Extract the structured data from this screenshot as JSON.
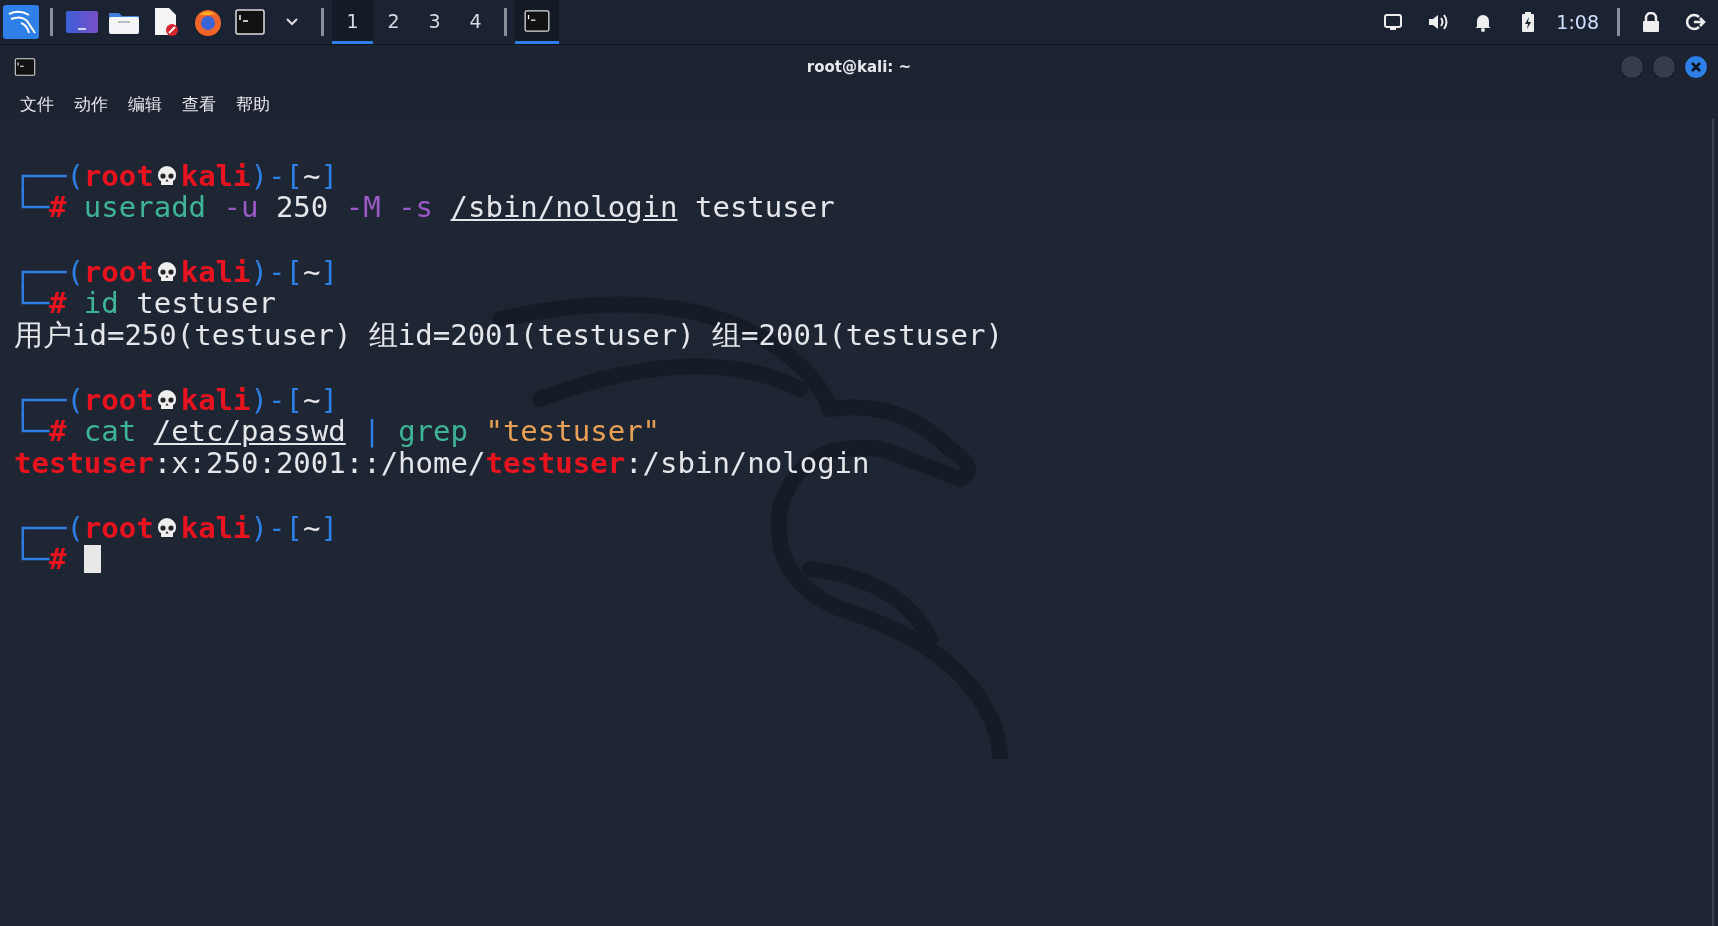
{
  "taskbar": {
    "launchers": [
      {
        "kind": "kali"
      },
      {
        "kind": "desktop"
      },
      {
        "kind": "folder"
      },
      {
        "kind": "editor"
      },
      {
        "kind": "browser"
      },
      {
        "kind": "terminal"
      },
      {
        "kind": "chevron"
      }
    ],
    "workspaces": [
      {
        "label": "1",
        "selected": true
      },
      {
        "label": "2",
        "selected": false
      },
      {
        "label": "3",
        "selected": false
      },
      {
        "label": "4",
        "selected": false
      }
    ],
    "tasks": [
      {
        "kind": "terminal",
        "selected": true
      }
    ],
    "tray": [
      {
        "kind": "display"
      },
      {
        "kind": "volume"
      },
      {
        "kind": "bell"
      },
      {
        "kind": "battery"
      }
    ],
    "clock": "1:08",
    "actions": [
      {
        "kind": "lock"
      },
      {
        "kind": "logout"
      }
    ]
  },
  "window": {
    "title": "root@kali: ~",
    "menu": [
      "文件",
      "动作",
      "编辑",
      "查看",
      "帮助"
    ],
    "blocks": [
      {
        "lines": [
          {
            "kind": "prompt",
            "tokens": [
              {
                "kind": "frame",
                "text": "┌──("
              },
              {
                "kind": "user",
                "text": "root"
              },
              {
                "kind": "skull"
              },
              {
                "kind": "user",
                "text": "kali"
              },
              {
                "kind": "frame",
                "text": ")-["
              },
              {
                "kind": "dir",
                "text": "~"
              },
              {
                "kind": "frame",
                "text": "]"
              }
            ]
          },
          {
            "kind": "command",
            "tokens": [
              {
                "kind": "frame",
                "text": "└─"
              },
              {
                "kind": "hash",
                "text": "# "
              },
              {
                "kind": "cmd",
                "text": "useradd"
              },
              {
                "kind": "flag",
                "text": " -u"
              },
              {
                "kind": "plain",
                "text": " 250 "
              },
              {
                "kind": "flag",
                "text": "-M -s "
              },
              {
                "kind": "path",
                "text": "/sbin/nologin"
              },
              {
                "kind": "plain",
                "text": " testuser"
              }
            ]
          }
        ]
      },
      {
        "lines": [
          {
            "kind": "prompt",
            "tokens": [
              {
                "kind": "frame",
                "text": "┌──("
              },
              {
                "kind": "user",
                "text": "root"
              },
              {
                "kind": "skull"
              },
              {
                "kind": "user",
                "text": "kali"
              },
              {
                "kind": "frame",
                "text": ")-["
              },
              {
                "kind": "dir",
                "text": "~"
              },
              {
                "kind": "frame",
                "text": "]"
              }
            ]
          },
          {
            "kind": "command",
            "tokens": [
              {
                "kind": "frame",
                "text": "└─"
              },
              {
                "kind": "hash",
                "text": "# "
              },
              {
                "kind": "cmd",
                "text": "id"
              },
              {
                "kind": "plain",
                "text": " testuser"
              }
            ]
          },
          {
            "kind": "output",
            "tokens": [
              {
                "kind": "plain",
                "text": "用户id=250(testuser) 组id=2001(testuser) 组=2001(testuser)"
              }
            ]
          }
        ]
      },
      {
        "lines": [
          {
            "kind": "prompt",
            "tokens": [
              {
                "kind": "frame",
                "text": "┌──("
              },
              {
                "kind": "user",
                "text": "root"
              },
              {
                "kind": "skull"
              },
              {
                "kind": "user",
                "text": "kali"
              },
              {
                "kind": "frame",
                "text": ")-["
              },
              {
                "kind": "dir",
                "text": "~"
              },
              {
                "kind": "frame",
                "text": "]"
              }
            ]
          },
          {
            "kind": "command",
            "tokens": [
              {
                "kind": "frame",
                "text": "└─"
              },
              {
                "kind": "hash",
                "text": "# "
              },
              {
                "kind": "cmd",
                "text": "cat "
              },
              {
                "kind": "path",
                "text": "/etc/passwd"
              },
              {
                "kind": "pipe",
                "text": " | "
              },
              {
                "kind": "cmd",
                "text": "grep "
              },
              {
                "kind": "string",
                "text": "\"testuser\""
              }
            ]
          },
          {
            "kind": "output",
            "tokens": [
              {
                "kind": "match",
                "text": "testuser"
              },
              {
                "kind": "plain",
                "text": ":x:250:2001::/home/"
              },
              {
                "kind": "match",
                "text": "testuser"
              },
              {
                "kind": "plain",
                "text": ":/sbin/nologin"
              }
            ]
          }
        ]
      },
      {
        "lines": [
          {
            "kind": "prompt",
            "tokens": [
              {
                "kind": "frame",
                "text": "┌──("
              },
              {
                "kind": "user",
                "text": "root"
              },
              {
                "kind": "skull"
              },
              {
                "kind": "user",
                "text": "kali"
              },
              {
                "kind": "frame",
                "text": ")-["
              },
              {
                "kind": "dir",
                "text": "~"
              },
              {
                "kind": "frame",
                "text": "]"
              }
            ]
          },
          {
            "kind": "command",
            "tokens": [
              {
                "kind": "frame",
                "text": "└─"
              },
              {
                "kind": "hash",
                "text": "# "
              },
              {
                "kind": "cursor"
              }
            ]
          }
        ]
      }
    ]
  }
}
